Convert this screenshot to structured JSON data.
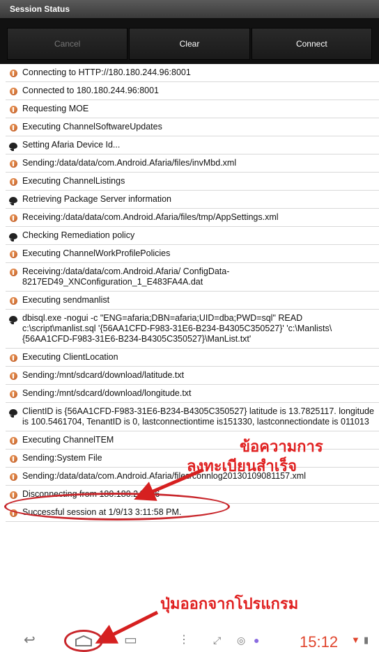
{
  "window": {
    "title": "Session Status"
  },
  "toolbar": {
    "cancel_label": "Cancel",
    "clear_label": "Clear",
    "connect_label": "Connect"
  },
  "log": [
    {
      "icon": "info-icon",
      "text": "Connecting to  HTTP://180.180.244.96:8001"
    },
    {
      "icon": "info-icon",
      "text": "Connected to 180.180.244.96:8001"
    },
    {
      "icon": "info-icon",
      "text": "Requesting MOE"
    },
    {
      "icon": "info-icon",
      "text": "Executing ChannelSoftwareUpdates"
    },
    {
      "icon": "message-icon",
      "text": "Setting Afaria Device Id..."
    },
    {
      "icon": "info-icon",
      "text": "Sending:/data/data/com.Android.Afaria/files/invMbd.xml"
    },
    {
      "icon": "info-icon",
      "text": "Executing ChannelListings"
    },
    {
      "icon": "message-icon",
      "text": "Retrieving Package Server information"
    },
    {
      "icon": "info-icon",
      "text": "Receiving:/data/data/com.Android.Afaria/files/tmp/AppSettings.xml"
    },
    {
      "icon": "message-icon",
      "text": "Checking Remediation policy"
    },
    {
      "icon": "info-icon",
      "text": "Executing ChannelWorkProfilePolicies"
    },
    {
      "icon": "info-icon",
      "text": "Receiving:/data/data/com.Android.Afaria/ ConfigData-8217ED49_XNConfiguration_1_E483FA4A.dat"
    },
    {
      "icon": "info-icon",
      "text": "Executing sendmanlist"
    },
    {
      "icon": "message-icon",
      "text": "dbisql.exe -nogui -c \"ENG=afaria;DBN=afaria;UID=dba;PWD=sql\" READ c:\\script\\manlist.sql '{56AA1CFD-F983-31E6-B234-B4305C350527}' 'c:\\Manlists\\{56AA1CFD-F983-31E6-B234-B4305C350527}\\ManList.txt'"
    },
    {
      "icon": "info-icon",
      "text": "Executing ClientLocation"
    },
    {
      "icon": "info-icon",
      "text": "Sending:/mnt/sdcard/download/latitude.txt"
    },
    {
      "icon": "info-icon",
      "text": "Sending:/mnt/sdcard/download/longitude.txt"
    },
    {
      "icon": "message-icon",
      "text": "ClientID is {56AA1CFD-F983-31E6-B234-B4305C350527} latitude is 13.7825117. longitude is 100.5461704, TenantID is 0, lastconnectiontime is151330, lastconnectiondate is 011013"
    },
    {
      "icon": "info-icon",
      "text": "Executing ChannelTEM"
    },
    {
      "icon": "info-icon",
      "text": "Sending:System File"
    },
    {
      "icon": "info-icon",
      "text": "Sending:/data/data/com.Android.Afaria/files/connlog20130109081157.xml"
    },
    {
      "icon": "info-icon",
      "text": "Disconnecting from 180.180.244.96"
    },
    {
      "icon": "info-icon",
      "text": "Successful session at 1/9/13 3:11:58 PM."
    }
  ],
  "annotations": {
    "line1": "ข้อความการ",
    "line2": "ลงทะเบียนสำเร็จ",
    "line3": "ปุ่มออกจากโปรแกรม"
  },
  "statusbar": {
    "time": "15:12"
  },
  "colors": {
    "annotation": "#e02020",
    "ellipse": "#c8262b",
    "clock": "#e0442c"
  }
}
